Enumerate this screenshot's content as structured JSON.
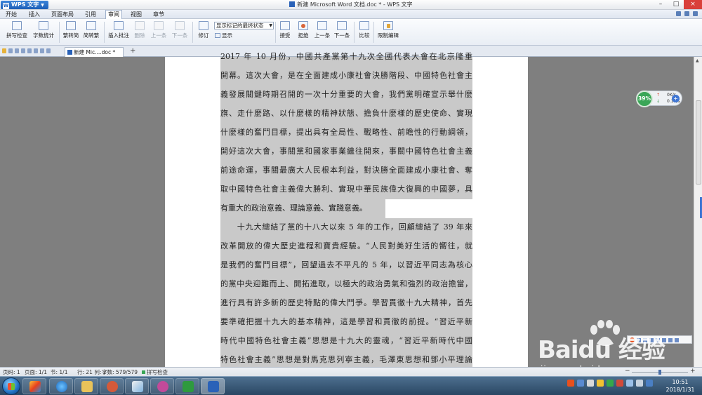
{
  "titlebar": {
    "app_button": "WPS 文字",
    "window_title": "新建 Microsoft Word 文档.doc * - WPS 文字"
  },
  "menu": [
    "开始",
    "插入",
    "页面布局",
    "引用",
    "审阅",
    "视图",
    "章节"
  ],
  "menu_active_index": 4,
  "ribbon": {
    "spellcheck": "拼写检查",
    "wordcount": "字数统计",
    "to_simplified": "繁转简",
    "to_traditional": "简转繁",
    "insert_comment": "插入批注",
    "delete": "删除",
    "prev_disabled": "上一条",
    "next_disabled": "下一条",
    "revise": "修订",
    "track_state": "显示标记的最终状态",
    "show": "显示",
    "accept": "接受",
    "reject": "拒绝",
    "prev": "上一条",
    "next": "下一条",
    "compare": "比较",
    "restrict_edit": "限制编辑"
  },
  "tabs": {
    "doc_tab": "新建 Mic....doc *",
    "new_tab": "+"
  },
  "document": {
    "lines": [
      "2017 年 10 月份，中國共產黨第十九次全國代表大會在北京隆重",
      "開幕。這次大會，是在全面建成小康社會決勝階段、中國特色社會主",
      "義發展關鍵時期召開的一次十分重要的大會，我們黨明確宣示舉什麼",
      "旗、走什麼路、以什麼樣的精神狀態、擔負什麼樣的歷史使命、實現",
      "什麼樣的奮鬥目標，提出具有全局性、戰略性、前瞻性的行動綱領，",
      "開好這次大會，事關黨和國家事業繼往開來，事關中國特色社會主義",
      "前途命運，事關最廣大人民根本利益，對決勝全面建成小康社會、奪",
      "取中國特色社會主義偉大勝利、實現中華民族偉大復興的中國夢，具",
      "有重大的政治意義、理論意義、實踐意義。",
      "　　十九大總結了黨的十八大以來 5 年的工作，回顧總結了 39 年來",
      "改革開放的偉大歷史進程和寶貴經驗。“人民對美好生活的嚮往，就",
      "是我們的奮鬥目標”，回望過去不平凡的 5 年，以習近平同志為核心",
      "的黨中央迎難而上、開拓進取，以極大的政治勇氣和強烈的政治擔當，",
      "進行具有許多新的歷史特點的偉大鬥爭。學習貫徹十九大精神，首先",
      "要準確把握十九大的基本精神，這是學習和貫徹的前提。“習近平新",
      "時代中國特色社會主義”思想是十九大的靈魂，“習近平新時代中國",
      "特色社會主義”思想是對馬克思列寧主義，毛澤東思想和鄧小平理論"
    ]
  },
  "speed_widget": {
    "percent": "39%",
    "up_label": "↑",
    "up_value": "0K/s",
    "down_label": "↓",
    "down_value": "0.1K/s",
    "plus": "+"
  },
  "statusbar": {
    "page_no": "页码: 1",
    "page": "页面: 1/1",
    "section": "节: 1/1",
    "row_col": "行: 21  列: 2",
    "char_count": "字数: 579/579",
    "spellcheck": "拼写检查",
    "zoom_minus": "−",
    "zoom_plus": "+"
  },
  "watermark": {
    "logo": "Baidu 经验",
    "url": "jingyan.baidu.com"
  },
  "taskbar": {
    "time": "10:51",
    "date": "2018/1/31"
  }
}
